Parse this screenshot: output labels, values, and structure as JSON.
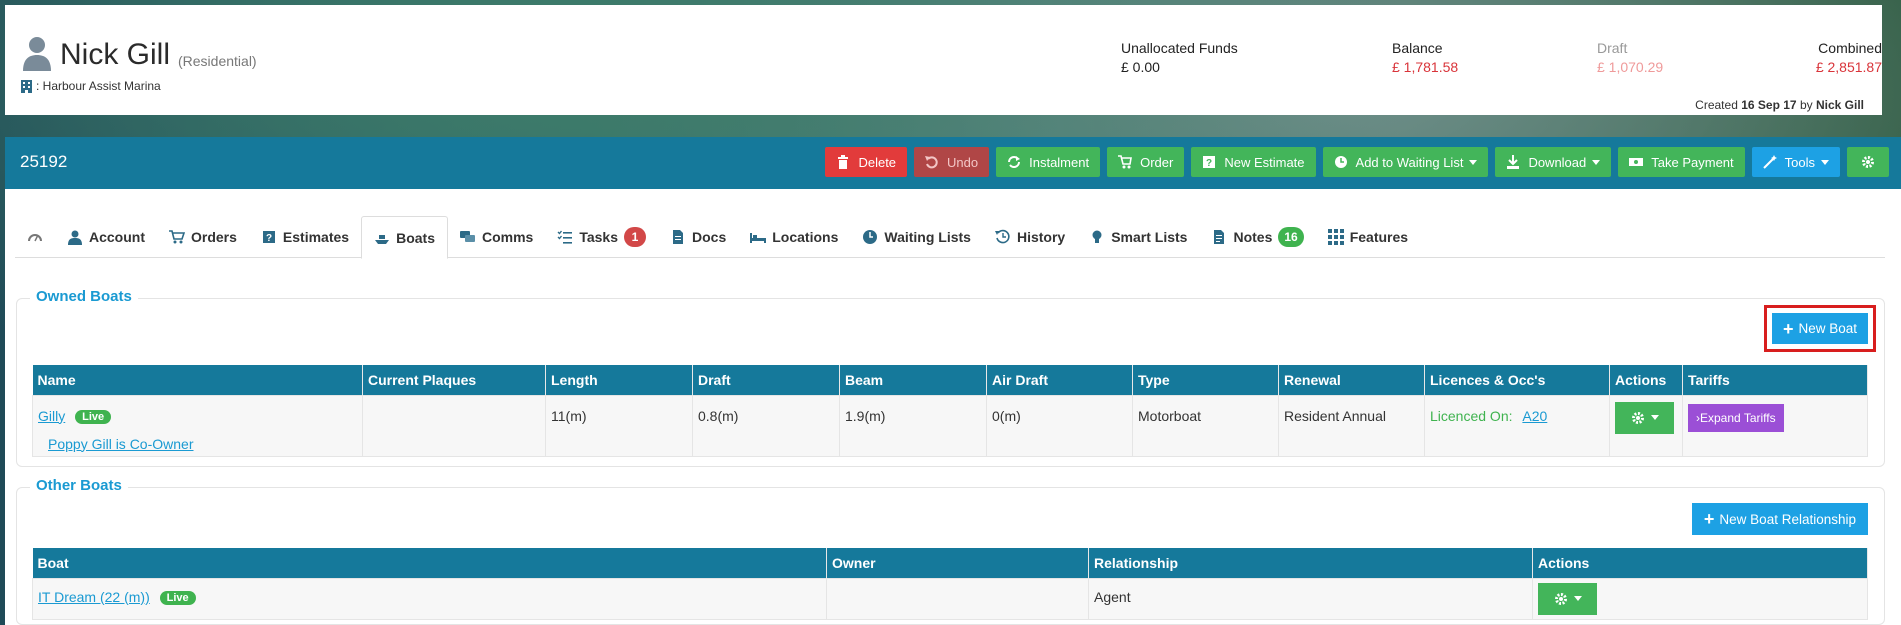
{
  "header": {
    "user_name": "Nick Gill",
    "user_type": "(Residential)",
    "marina": ": Harbour Assist Marina",
    "funds": {
      "unallocated_label": "Unallocated Funds",
      "unallocated_value": "£ 0.00",
      "balance_label": "Balance",
      "balance_value": "£ 1,781.58",
      "draft_label": "Draft",
      "draft_value": "£ 1,070.29",
      "combined_label": "Combined",
      "combined_value": "£ 2,851.87"
    },
    "created_prefix": "Created",
    "created_date": "16 Sep 17",
    "created_by_prefix": "by",
    "created_by": "Nick Gill"
  },
  "record": {
    "id": "25192",
    "toolbar": {
      "delete": "Delete",
      "undo": "Undo",
      "instalment": "Instalment",
      "order": "Order",
      "new_estimate": "New Estimate",
      "add_waiting": "Add to Waiting List",
      "download": "Download",
      "take_payment": "Take Payment",
      "tools": "Tools"
    }
  },
  "tabs": {
    "account": "Account",
    "orders": "Orders",
    "estimates": "Estimates",
    "boats": "Boats",
    "comms": "Comms",
    "tasks": "Tasks",
    "tasks_count": "1",
    "docs": "Docs",
    "locations": "Locations",
    "waiting_lists": "Waiting Lists",
    "history": "History",
    "smart_lists": "Smart Lists",
    "notes": "Notes",
    "notes_count": "16",
    "features": "Features"
  },
  "owned": {
    "title": "Owned Boats",
    "new_button": "New Boat",
    "columns": {
      "name": "Name",
      "plaques": "Current Plaques",
      "length": "Length",
      "draft": "Draft",
      "beam": "Beam",
      "air_draft": "Air Draft",
      "type": "Type",
      "renewal": "Renewal",
      "licences": "Licences & Occ's",
      "actions": "Actions",
      "tariffs": "Tariffs"
    },
    "row": {
      "name": "Gilly",
      "status": "Live",
      "coowner": "Poppy Gill is Co-Owner",
      "plaques": "",
      "length": "11(m)",
      "draft": "0.8(m)",
      "beam": "1.9(m)",
      "air_draft": "0(m)",
      "type": "Motorboat",
      "renewal": "Resident Annual",
      "licence_label": "Licenced On:",
      "licence_link": "A20",
      "expand": "Expand Tariffs"
    }
  },
  "other": {
    "title": "Other Boats",
    "new_button": "New Boat Relationship",
    "columns": {
      "boat": "Boat",
      "owner": "Owner",
      "relationship": "Relationship",
      "actions": "Actions"
    },
    "row": {
      "boat": "IT Dream (22 (m))",
      "status": "Live",
      "owner": "",
      "relationship": "Agent"
    }
  }
}
